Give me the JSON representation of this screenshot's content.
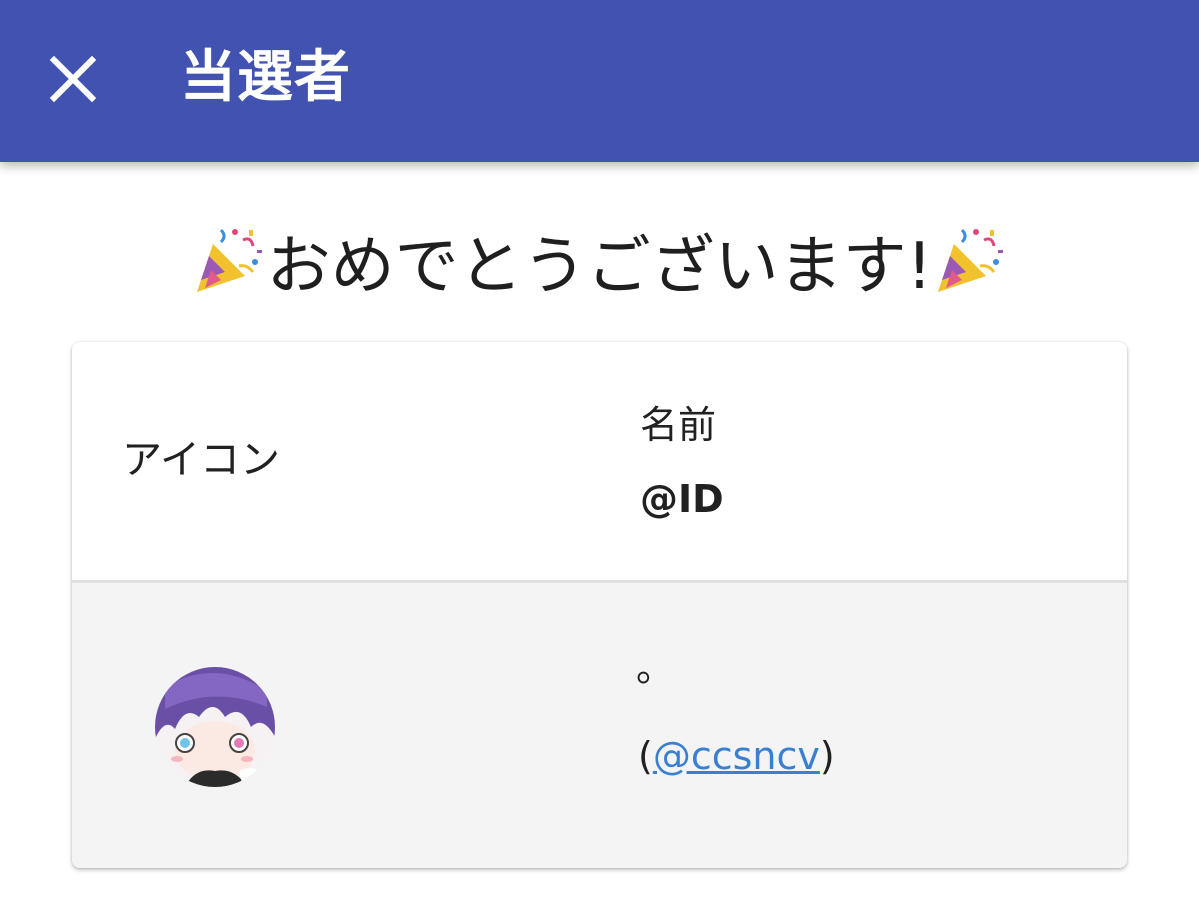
{
  "appbar": {
    "title": "当選者",
    "close_icon": "close-icon",
    "background_color": "#4252b0"
  },
  "headline": {
    "text": "おめでとうございます!",
    "emoji_icon": "party-popper-icon"
  },
  "table": {
    "header": {
      "icon_label": "アイコン",
      "name_label": "名前",
      "id_label": "@ID"
    },
    "rows": [
      {
        "avatar_icon": "avatar",
        "name": "。",
        "open_paren": "(",
        "handle": "@ccsncv",
        "close_paren": ")"
      }
    ]
  },
  "colors": {
    "link": "#3b7fd0",
    "row_background": "#f4f4f4"
  }
}
